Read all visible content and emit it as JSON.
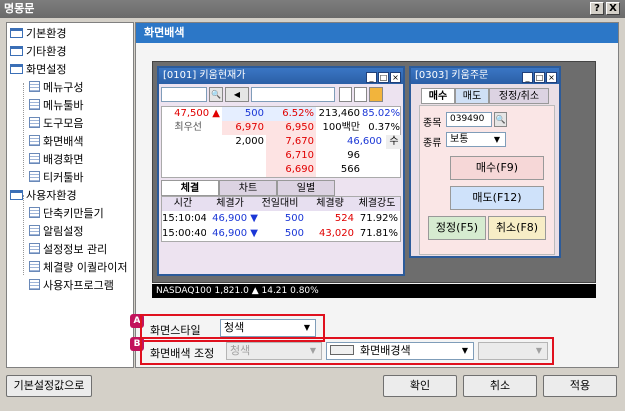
{
  "window": {
    "title": "명몽문",
    "help_btn": "?",
    "close_btn": "X"
  },
  "tree": [
    {
      "label": "기본환경",
      "type": "folder"
    },
    {
      "label": "기타환경",
      "type": "folder"
    },
    {
      "label": "화면설정",
      "type": "folder"
    },
    {
      "label": "메뉴구성",
      "type": "leaf"
    },
    {
      "label": "메뉴툴바",
      "type": "leaf"
    },
    {
      "label": "도구모음",
      "type": "leaf"
    },
    {
      "label": "화면배색",
      "type": "leaf"
    },
    {
      "label": "배경화면",
      "type": "leaf"
    },
    {
      "label": "티커툴바",
      "type": "leaf"
    },
    {
      "label": "사용자환경",
      "type": "folder"
    },
    {
      "label": "단축키만들기",
      "type": "leaf"
    },
    {
      "label": "알림설정",
      "type": "leaf"
    },
    {
      "label": "설정정보 관리",
      "type": "leaf"
    },
    {
      "label": "체결량 이퀄라이저",
      "type": "leaf"
    },
    {
      "label": "사용자프로그램",
      "type": "leaf"
    }
  ],
  "panel": {
    "title": "화면배색"
  },
  "preview": {
    "win1": {
      "title": "[0101] 키움현재가",
      "quote_rows": [
        [
          "47,500 ▲",
          "500",
          "6.52%",
          "213,460",
          "85.02%"
        ],
        [
          "최우선",
          "6,970",
          "6,950",
          "100백만",
          "0.37%"
        ],
        [
          "",
          "2,000",
          "7,670",
          "46,600",
          "수"
        ],
        [
          "",
          "",
          "6,710",
          "96",
          ""
        ],
        [
          "",
          "",
          "6,690",
          "566",
          ""
        ]
      ],
      "tabs": [
        "체결",
        "차트",
        "일별"
      ],
      "trade_header": [
        "시간",
        "체결가",
        "전일대비",
        "체결량",
        "체결강도"
      ],
      "trade_rows": [
        [
          "15:10:04",
          "46,900 ▼",
          "500",
          "524",
          "71.92%"
        ],
        [
          "15:00:40",
          "46,900 ▼",
          "500",
          "43,020",
          "71.81%"
        ]
      ]
    },
    "win2": {
      "title": "[0303] 키움주문",
      "tabs": [
        "매수",
        "매도",
        "정정/취소"
      ],
      "code_label": "종목",
      "code_value": "039490",
      "type_label": "종류",
      "type_value": "보통",
      "buy_btn": "매수(F9)",
      "sell_btn": "매도(F12)",
      "modify_btn": "정정(F5)",
      "cancel_btn": "취소(F8)"
    },
    "status": "NASDAQ100  1,821.0 ▲ 14.21  0.80%"
  },
  "option_a": {
    "badge": "A",
    "label": "화면스타일",
    "value": "청색"
  },
  "option_b": {
    "badge": "B",
    "label": "화면배색 조정",
    "value1": "청색",
    "value2": "화면배경색",
    "value3": ""
  },
  "buttons": {
    "reset": "기본설정값으로",
    "ok": "확인",
    "cancel": "취소",
    "apply": "적용"
  },
  "colors": {
    "accent": "#2c77c7",
    "highlight": "#e0101e",
    "badge": "#c2125c"
  }
}
